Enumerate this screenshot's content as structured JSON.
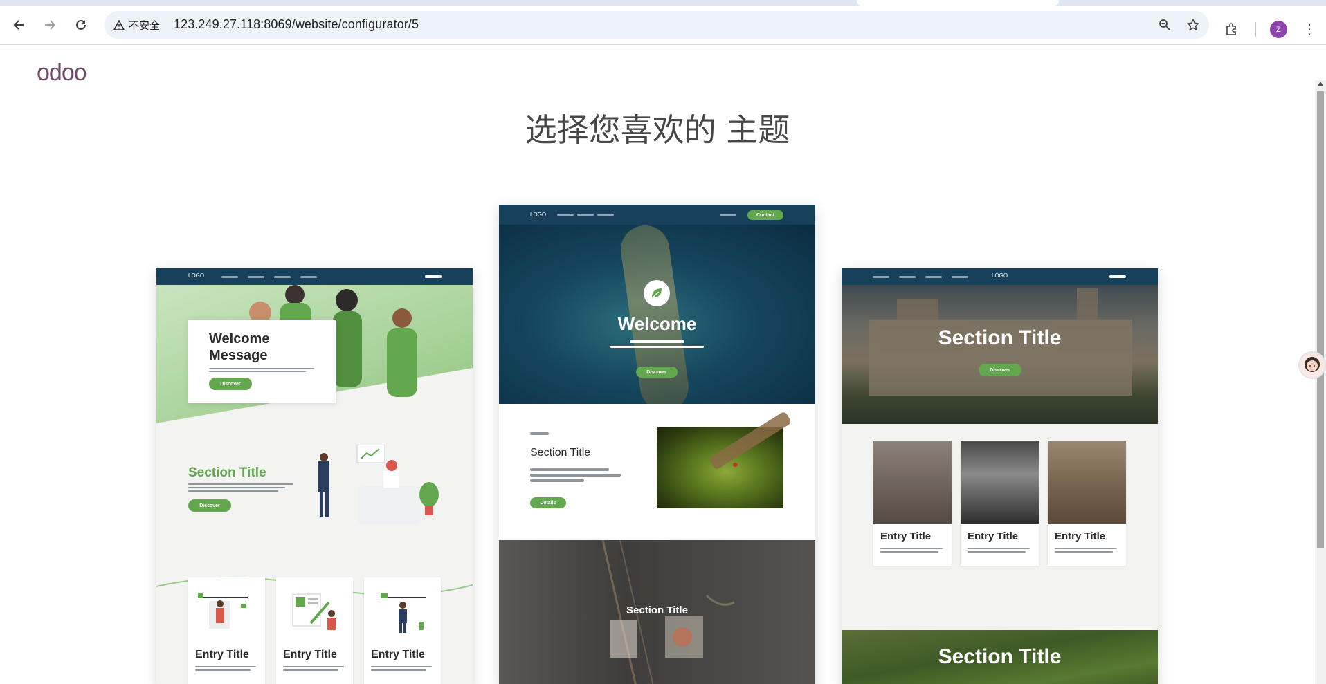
{
  "browser": {
    "security_label": "不安全",
    "url": "123.249.27.118:8069/website/configurator/5",
    "avatar_letter": "Z"
  },
  "page": {
    "logo": "odoo",
    "heading_main": "选择您喜欢的",
    "heading_accent": "主题"
  },
  "themes": [
    {
      "nav_logo": "LOGO",
      "welcome_title": "Welcome Message",
      "hero_button": "Discover",
      "section_title": "Section Title",
      "section_button": "Discover",
      "entries": [
        "Entry Title",
        "Entry Title",
        "Entry Title"
      ]
    },
    {
      "nav_logo": "LOGO",
      "nav_button": "Contact",
      "welcome_title": "Welcome",
      "hero_button": "Discover",
      "section_title": "Section Title",
      "section_button": "Details",
      "bottom_title": "Section Title"
    },
    {
      "nav_logo": "LOGO",
      "hero_title": "Section Title",
      "hero_button": "Discover",
      "entries": [
        "Entry Title",
        "Entry Title",
        "Entry Title"
      ],
      "bottom_title": "Section Title"
    }
  ],
  "colors": {
    "accent_green": "#63a84f",
    "nav_dark": "#17415a",
    "odoo_purple": "#714b67"
  }
}
